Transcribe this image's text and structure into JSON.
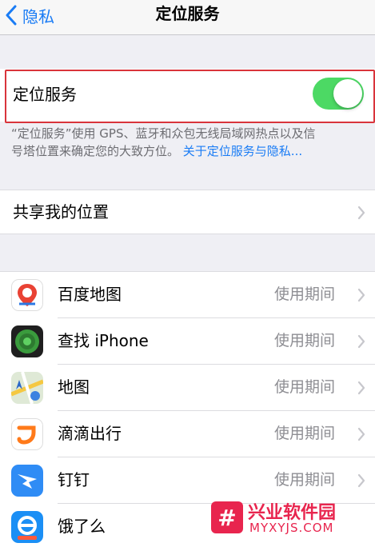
{
  "nav": {
    "back_label": "隐私",
    "title": "定位服务"
  },
  "location_services": {
    "label": "定位服务",
    "enabled": true
  },
  "footnote": {
    "text_line1": "“定位服务”使用 GPS、蓝牙和众包无线局域网热点以及信",
    "text_line2": "号塔位置来确定您的大致方位。",
    "link": "关于定位服务与隐私..."
  },
  "share_location": {
    "label": "共享我的位置"
  },
  "apps": [
    {
      "name": "百度地图",
      "status": "使用期间",
      "icon": "baidu-maps-icon"
    },
    {
      "name": "查找 iPhone",
      "status": "使用期间",
      "icon": "find-iphone-icon"
    },
    {
      "name": "地图",
      "status": "使用期间",
      "icon": "apple-maps-icon"
    },
    {
      "name": "滴滴出行",
      "status": "使用期间",
      "icon": "didi-icon"
    },
    {
      "name": "钉钉",
      "status": "使用期间",
      "icon": "dingtalk-icon"
    },
    {
      "name": "饿了么",
      "status": "",
      "icon": "eleme-icon"
    }
  ],
  "watermark": {
    "logo_glyph": "#",
    "name": "兴业软件园",
    "domain": "MYXYJS.COM"
  },
  "colors": {
    "ios_blue": "#1a7cf5",
    "toggle_green": "#4cd964",
    "highlight_red": "#d9343b",
    "watermark_red": "#e8254e"
  }
}
